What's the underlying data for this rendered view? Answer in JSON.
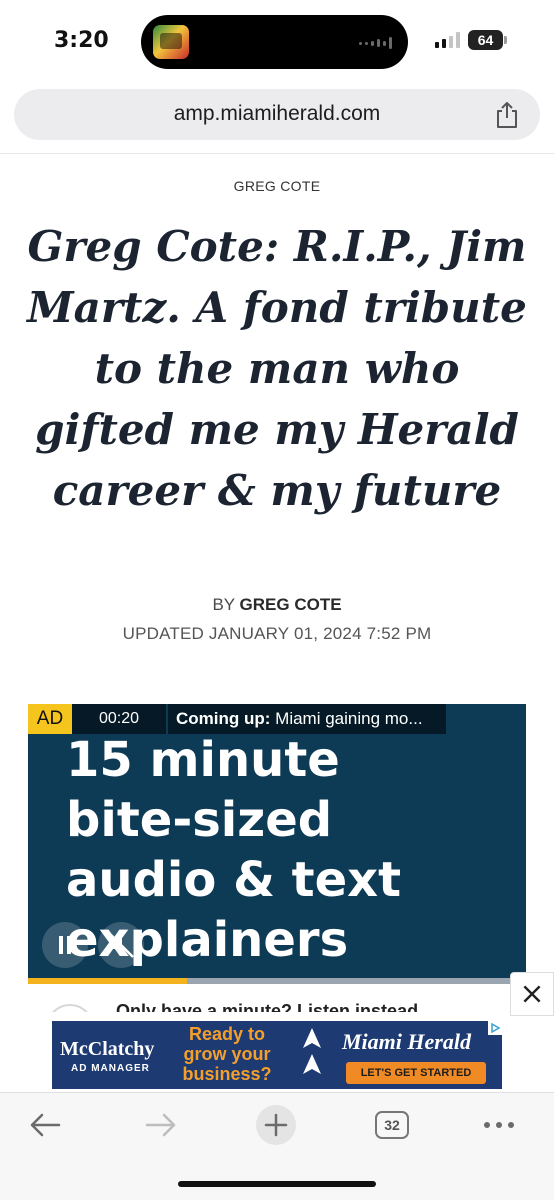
{
  "status": {
    "time": "3:20",
    "battery": "64"
  },
  "browser": {
    "url": "amp.miamiherald.com",
    "tab_count": "32"
  },
  "article": {
    "section": "GREG COTE",
    "headline": "Greg Cote: R.I.P., Jim Martz. A fond tribute to the man who gifted me my Herald career & my future",
    "byline_prefix": "BY",
    "byline_author": "GREG COTE",
    "updated": "UPDATED JANUARY 01, 2024 7:52 PM"
  },
  "video_ad": {
    "badge": "AD",
    "timer": "00:20",
    "coming_label": "Coming up:",
    "coming_text": "Miami gaining mo...",
    "lines": [
      "15 minute",
      "bite-sized",
      "audio & text",
      "explainers"
    ],
    "progress": 0.32
  },
  "listen": {
    "text": "Only have a minute? Listen instead"
  },
  "banner_ad": {
    "brand": "McClatchy",
    "brand_sub": "AD MANAGER",
    "ready_lines": [
      "Ready to",
      "grow your",
      "business?"
    ],
    "partner": "Miami Herald",
    "cta": "LET'S GET STARTED"
  },
  "colors": {
    "headline": "#1b2430",
    "video_bg": "#0d3a55",
    "ad_badge": "#f6c51d",
    "banner_bg": "#1d3a72",
    "banner_accent": "#f59f2b"
  }
}
